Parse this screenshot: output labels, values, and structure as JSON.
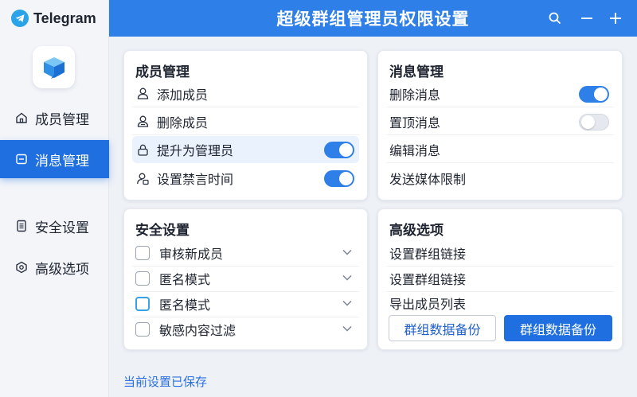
{
  "app": {
    "brand": "Telegram",
    "title": "超级群组管理员权限设置"
  },
  "colors": {
    "accent": "#2f7fe8",
    "sidebar_active": "#1f6fe0",
    "brand_logo": "#2aa3e8"
  },
  "header_actions": [
    {
      "name": "search-icon"
    },
    {
      "name": "minimize-icon"
    },
    {
      "name": "add-icon"
    }
  ],
  "sidebar": {
    "items": [
      {
        "label": "成员管理",
        "icon": "home-icon",
        "active": false
      },
      {
        "label": "消息管理",
        "icon": "message-icon",
        "active": true
      },
      {
        "label": "安全设置",
        "icon": "document-icon",
        "active": false
      },
      {
        "label": "高级选项",
        "icon": "hexagon-gear-icon",
        "active": false
      }
    ]
  },
  "member_card": {
    "title": "成员管理",
    "rows": [
      {
        "label": "添加成员",
        "icon": "user-add-icon"
      },
      {
        "label": "删除成员",
        "icon": "user-remove-icon"
      },
      {
        "label": "提升为管理员",
        "icon": "lock-icon",
        "toggle": true
      },
      {
        "label": "设置禁言时间",
        "icon": "user-mute-icon",
        "toggle": true
      }
    ]
  },
  "message_card": {
    "title": "消息管理",
    "rows": [
      {
        "label": "删除消息",
        "toggle": true
      },
      {
        "label": "置顶消息",
        "toggle": false
      },
      {
        "label": "编辑消息"
      },
      {
        "label": "发送媒体限制"
      }
    ]
  },
  "security_card": {
    "title": "安全设置",
    "rows": [
      {
        "label": "审核新成员",
        "checked": false
      },
      {
        "label": "匿名模式",
        "checked": false
      },
      {
        "label": "匿名模式",
        "checked": false,
        "focused": true
      },
      {
        "label": "敏感内容过滤",
        "checked": false
      }
    ]
  },
  "advanced_card": {
    "title": "高级选项",
    "rows": [
      {
        "label": "设置群组链接"
      },
      {
        "label": "设置群组链接"
      },
      {
        "label": "导出成员列表"
      }
    ],
    "buttons": {
      "secondary": "群组数据备份",
      "primary": "群组数据备份"
    }
  },
  "status": {
    "text": "当前设置已保存"
  }
}
